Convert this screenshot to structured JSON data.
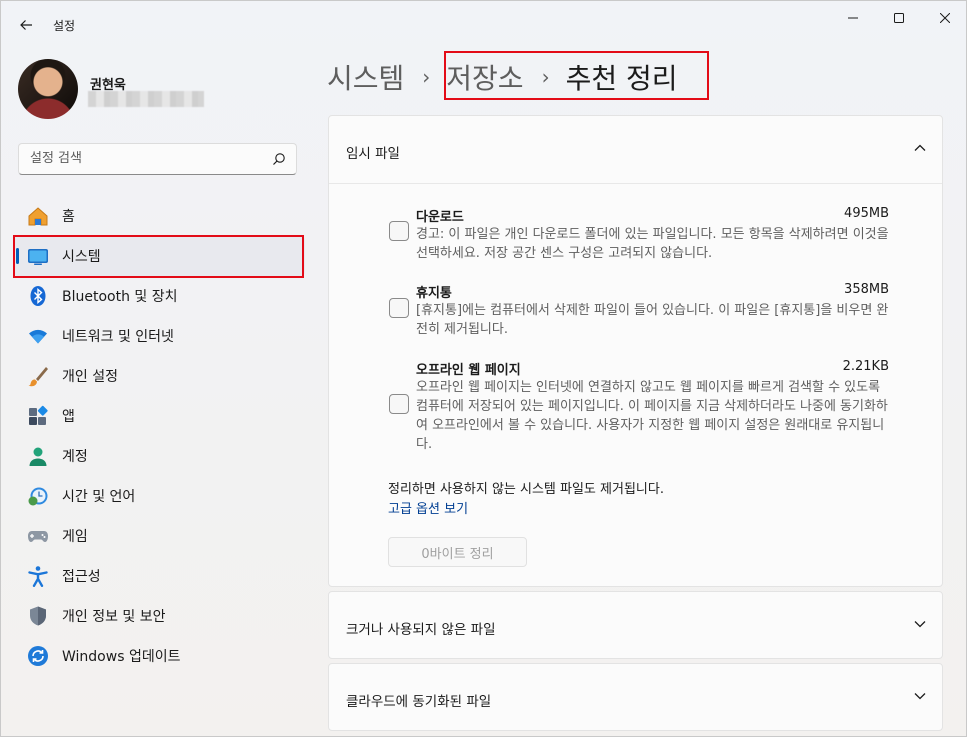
{
  "window": {
    "title": "설정",
    "controls": {
      "minimize": "minimize-icon",
      "maximize": "maximize-icon",
      "close": "close-icon"
    }
  },
  "profile": {
    "name": "권현욱"
  },
  "search": {
    "placeholder": "설정 검색"
  },
  "sidebar": {
    "items": [
      {
        "label": "홈",
        "icon": "home-icon"
      },
      {
        "label": "시스템",
        "icon": "system-icon",
        "active": true
      },
      {
        "label": "Bluetooth 및 장치",
        "icon": "bluetooth-icon"
      },
      {
        "label": "네트워크 및 인터넷",
        "icon": "wifi-icon"
      },
      {
        "label": "개인 설정",
        "icon": "brush-icon"
      },
      {
        "label": "앱",
        "icon": "apps-icon"
      },
      {
        "label": "계정",
        "icon": "account-icon"
      },
      {
        "label": "시간 및 언어",
        "icon": "time-language-icon"
      },
      {
        "label": "게임",
        "icon": "gamepad-icon"
      },
      {
        "label": "접근성",
        "icon": "accessibility-icon"
      },
      {
        "label": "개인 정보 및 보안",
        "icon": "shield-icon"
      },
      {
        "label": "Windows 업데이트",
        "icon": "update-icon"
      }
    ]
  },
  "breadcrumb": {
    "items": [
      "시스템",
      "저장소",
      "추천 정리"
    ],
    "separator": "›"
  },
  "temp_files": {
    "title": "임시 파일",
    "files": [
      {
        "name": "다운로드",
        "size": "495MB",
        "description": "경고: 이 파일은 개인 다운로드 폴더에 있는 파일입니다. 모든 항목을 삭제하려면 이것을 선택하세요. 저장 공간 센스 구성은 고려되지 않습니다."
      },
      {
        "name": "휴지통",
        "size": "358MB",
        "description": "[휴지통]에는 컴퓨터에서 삭제한 파일이 들어 있습니다. 이 파일은 [휴지통]을 비우면 완전히 제거됩니다."
      },
      {
        "name": "오프라인 웹 페이지",
        "size": "2.21KB",
        "description": "오프라인 웹 페이지는 인터넷에 연결하지 않고도 웹 페이지를 빠르게 검색할 수 있도록 컴퓨터에 저장되어 있는 페이지입니다. 이 페이지를 지금 삭제하더라도 나중에 동기화하여 오프라인에서 볼 수 있습니다. 사용자가 지정한 웹 페이지 설정은 원래대로 유지됩니다."
      }
    ],
    "note": "정리하면 사용하지 않는 시스템 파일도 제거됩니다.",
    "advanced_link": "고급 옵션 보기",
    "cleanup_button": "0바이트 정리"
  },
  "sections": [
    {
      "title": "크거나 사용되지 않은 파일"
    },
    {
      "title": "클라우드에 동기화된 파일"
    }
  ],
  "colors": {
    "accent": "#005fb8",
    "highlight_box": "#e30b17",
    "link": "#003e92"
  }
}
